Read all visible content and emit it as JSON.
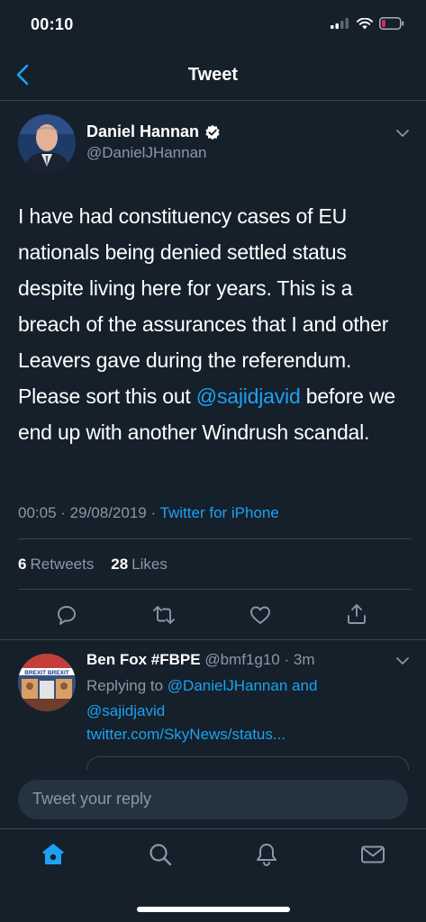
{
  "status_bar": {
    "time": "00:10"
  },
  "header": {
    "title": "Tweet"
  },
  "tweet": {
    "author_name": "Daniel Hannan",
    "author_handle": "@DanielJHannan",
    "text_before": "I have had constituency cases of EU nationals being denied settled status despite living here for years. This is a breach of the assurances that I and other Leavers gave during the referendum. Please sort this out ",
    "mention": "@sajidjavid",
    "text_after": " before we end up with another Windrush scandal.",
    "time": "00:05",
    "date": "29/08/2019",
    "source": "Twitter for iPhone",
    "retweets_count": "6",
    "retweets_label": "Retweets",
    "likes_count": "28",
    "likes_label": "Likes"
  },
  "reply": {
    "author_name": "Ben Fox #FBPE",
    "author_handle": "@bmf1g10",
    "age": "3m",
    "replying_prefix": "Replying to",
    "replying_user1": "@DanielJHannan",
    "replying_and": "and",
    "replying_user2": "@sajidjavid",
    "link": "twitter.com/SkyNews/status...",
    "avatar_text": "BREXIT BREXIT"
  },
  "composer": {
    "placeholder": "Tweet your reply"
  },
  "colors": {
    "background": "#15202b",
    "accent": "#1da1f2",
    "muted": "#8899a6",
    "divider": "#38444d",
    "battery_low": "#e0245e"
  }
}
